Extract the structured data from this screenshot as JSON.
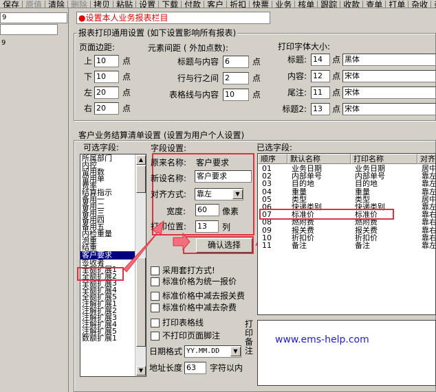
{
  "toolbar": {
    "items": [
      "保存",
      "原值",
      "清除",
      "删除",
      "拷贝",
      "粘贴",
      "设置",
      "下载",
      "付款",
      "客户",
      "折扣",
      "快票",
      "业务",
      "核单",
      "跟踪",
      "收款",
      "查单",
      "打单",
      "杂收",
      "杂"
    ]
  },
  "left_pane": {
    "row1": "9",
    "row2": "9"
  },
  "header": {
    "title": "●设置本人业务报表栏目"
  },
  "print_settings": {
    "group_title": "报表打印通用设置 (如下设置影响所有报表)",
    "margin": {
      "title": "页面边距:",
      "unit": "点",
      "items": [
        {
          "label": "上",
          "value": "10"
        },
        {
          "label": "下",
          "value": "10"
        },
        {
          "label": "左",
          "value": "20"
        },
        {
          "label": "右",
          "value": "20"
        }
      ]
    },
    "spacing": {
      "title": "元素间距 ( 外加点数):",
      "unit": "点",
      "items": [
        {
          "label": "标题与内容",
          "value": "6"
        },
        {
          "label": "行与行之间",
          "value": "2"
        },
        {
          "label": "表格线与内容",
          "value": "10"
        }
      ]
    },
    "font": {
      "title": "打印字体大小:",
      "unit": "点",
      "items": [
        {
          "label": "标题:",
          "size": "14",
          "face": "黑体"
        },
        {
          "label": "内容:",
          "size": "12",
          "face": "宋体"
        },
        {
          "label": "尾注:",
          "size": "11",
          "face": "宋体"
        },
        {
          "label": "标题2:",
          "size": "13",
          "face": "宋体"
        }
      ]
    }
  },
  "customer_settings": {
    "group_title": "客户业务结算清单设置 (设置为用户个人设置)",
    "available_title": "可选字段:",
    "available_fields": [
      "所属部门",
      "内控",
      "留用数",
      "留用单",
      "费率",
      "结算指示",
      "备用一",
      "备用二",
      "备用三",
      "备用四",
      "备用五",
      "内检重量",
      "泡重",
      "结重",
      "客户要求",
      "签收者",
      "全额扩展1",
      "全额扩展2",
      "全额扩展3",
      "全额扩展4",
      "全额扩展5",
      "注解扩展1",
      "注解扩展2",
      "注解扩展3",
      "注解扩展4",
      "注解扩展5",
      "数额扩展1"
    ],
    "selected_available": "客户要求",
    "field_title": "字段设置:",
    "original_name_label": "原来名称:",
    "original_name_value": "客户要求",
    "new_name_label": "新设名称:",
    "new_name_value": "客户要求",
    "align_label": "对齐方式:",
    "align_value": "靠左",
    "width_label": "宽度:",
    "width_value": "60",
    "width_unit": "像素",
    "print_pos_label": "打印位置:",
    "print_pos_value": "13",
    "print_pos_unit": "列",
    "confirm_button": "确认选择",
    "options": [
      "采用套打方式!",
      "标准价格为统一报价",
      "标准价格中减去报关费",
      "标准价格中减去杂费",
      "打印表格线",
      "不打印页面脚注"
    ],
    "date_format_label": "日期格式",
    "date_format_value": "YY.MM.DD",
    "addr_len_label": "地址长度",
    "addr_len_value": "63",
    "addr_len_unit": "字符以内",
    "selected_title": "已选字段:",
    "columns": [
      "顺序",
      "默认名称",
      "打印名称",
      "对齐"
    ],
    "rows": [
      [
        "01",
        "业务日期",
        "业务日期",
        "居中"
      ],
      [
        "02",
        "内部单号",
        "内部单号",
        "靠左"
      ],
      [
        "03",
        "目的地",
        "目的地",
        "靠左"
      ],
      [
        "04",
        "重量",
        "重量",
        "靠左"
      ],
      [
        "05",
        "类型",
        "类型",
        "居中"
      ],
      [
        "06",
        "快递类别",
        "快递类别",
        "靠左"
      ],
      [
        "07",
        "标准价",
        "标准价",
        "靠右"
      ],
      [
        "08",
        "燃附费",
        "燃附费",
        "靠右"
      ],
      [
        "09",
        "报关费",
        "报关费",
        "靠右"
      ],
      [
        "10",
        "折扣价",
        "折扣价",
        "靠右"
      ],
      [
        "11",
        "备注",
        "备注",
        "靠左"
      ]
    ],
    "footnote_label": "打印备注",
    "footnote_text": "www.ems-help.com"
  },
  "colors": {
    "red_annotation": "#e03040",
    "title_red": "#e00000",
    "selection": "#000080",
    "watermark": "#2020d0"
  }
}
